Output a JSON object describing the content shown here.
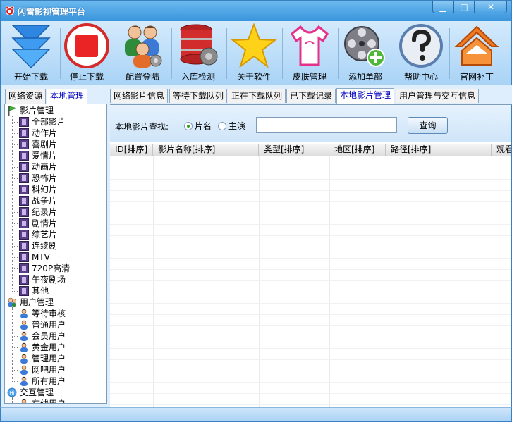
{
  "window": {
    "title": "闪雷影视管理平台",
    "controls": [
      "minimize",
      "maximize",
      "close"
    ]
  },
  "toolbar": {
    "items": [
      {
        "label": "开始下载",
        "icon": "download-arrow-icon"
      },
      {
        "label": "停止下载",
        "icon": "stop-icon"
      },
      {
        "label": "配置登陆",
        "icon": "users-config-icon"
      },
      {
        "label": "入库检测",
        "icon": "database-gear-icon"
      },
      {
        "label": "关于软件",
        "icon": "star-icon"
      },
      {
        "label": "皮肤管理",
        "icon": "shirt-icon"
      },
      {
        "label": "添加单部",
        "icon": "film-reel-add-icon"
      },
      {
        "label": "帮助中心",
        "icon": "help-icon"
      },
      {
        "label": "官网补丁",
        "icon": "home-icon"
      }
    ]
  },
  "left_tabs": [
    {
      "label": "网络资源",
      "active": false
    },
    {
      "label": "本地管理",
      "active": true
    }
  ],
  "tree": {
    "groups": [
      {
        "label": "影片管理",
        "icon": "flag-icon",
        "children": [
          "全部影片",
          "动作片",
          "喜剧片",
          "爱情片",
          "动画片",
          "恐怖片",
          "科幻片",
          "战争片",
          "纪录片",
          "剧情片",
          "综艺片",
          "连续剧",
          "MTV",
          "720P高清",
          "午夜剧场",
          "其他"
        ]
      },
      {
        "label": "用户管理",
        "icon": "user-group-icon",
        "children": [
          "等待审核",
          "普通用户",
          "会员用户",
          "黄金用户",
          "管理用户",
          "网吧用户",
          "所有用户"
        ]
      },
      {
        "label": "交互管理",
        "icon": "chat-icon",
        "children": [
          "在线用户"
        ]
      }
    ]
  },
  "right_tabs": [
    {
      "label": "网络影片信息",
      "active": false
    },
    {
      "label": "等待下载队列",
      "active": false
    },
    {
      "label": "正在下载队列",
      "active": false
    },
    {
      "label": "已下载记录",
      "active": false
    },
    {
      "label": "本地影片管理",
      "active": true
    },
    {
      "label": "用户管理与交互信息",
      "active": false
    }
  ],
  "search": {
    "label": "本地影片查找:",
    "options": [
      {
        "label": "片名",
        "selected": true
      },
      {
        "label": "主演",
        "selected": false
      }
    ],
    "value": "",
    "button": "查询"
  },
  "table": {
    "columns": [
      "ID[排序]",
      "影片名称[排序]",
      "类型[排序]",
      "地区[排序]",
      "路径[排序]",
      "观看"
    ],
    "rows": []
  }
}
